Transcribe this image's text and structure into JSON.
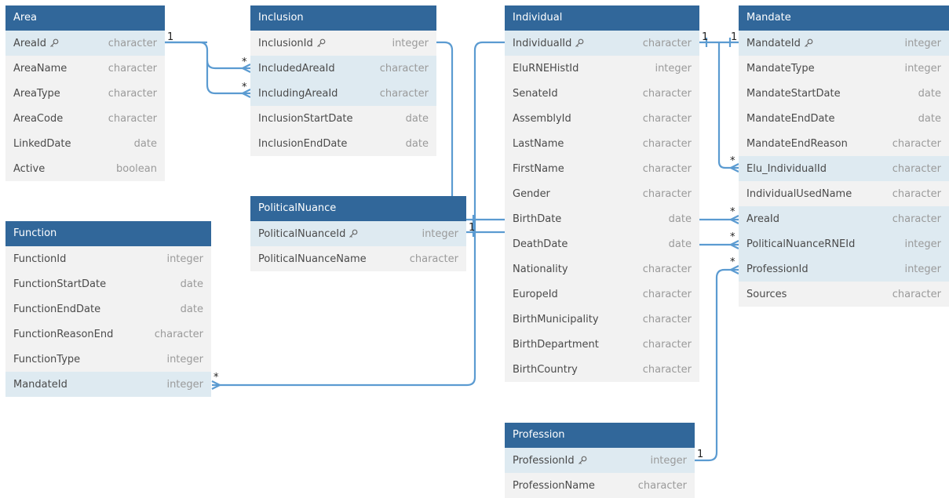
{
  "colors": {
    "header": "#31679a",
    "header_text": "#ffffff",
    "body": "#f2f2f2",
    "highlight_row": "#deeaf1",
    "relation": "#5b9bd1",
    "name_text": "#4a4a4a",
    "type_text": "#9a9a9a"
  },
  "tables": {
    "area": {
      "title": "Area",
      "columns": [
        {
          "name": "AreaId",
          "type": "character",
          "pk": true,
          "hl": true
        },
        {
          "name": "AreaName",
          "type": "character"
        },
        {
          "name": "AreaType",
          "type": "character"
        },
        {
          "name": "AreaCode",
          "type": "character"
        },
        {
          "name": "LinkedDate",
          "type": "date"
        },
        {
          "name": "Active",
          "type": "boolean"
        }
      ]
    },
    "inclusion": {
      "title": "Inclusion",
      "columns": [
        {
          "name": "InclusionId",
          "type": "integer",
          "pk": true
        },
        {
          "name": "IncludedAreaId",
          "type": "character",
          "hl": true
        },
        {
          "name": "IncludingAreaId",
          "type": "character",
          "hl": true
        },
        {
          "name": "InclusionStartDate",
          "type": "date"
        },
        {
          "name": "InclusionEndDate",
          "type": "date"
        }
      ]
    },
    "individual": {
      "title": "Individual",
      "columns": [
        {
          "name": "IndividualId",
          "type": "character",
          "pk": true,
          "hl": true
        },
        {
          "name": "EluRNEHistId",
          "type": "integer"
        },
        {
          "name": "SenateId",
          "type": "character"
        },
        {
          "name": "AssemblyId",
          "type": "character"
        },
        {
          "name": "LastName",
          "type": "character"
        },
        {
          "name": "FirstName",
          "type": "character"
        },
        {
          "name": "Gender",
          "type": "character"
        },
        {
          "name": "BirthDate",
          "type": "date"
        },
        {
          "name": "DeathDate",
          "type": "date"
        },
        {
          "name": "Nationality",
          "type": "character"
        },
        {
          "name": "EuropeId",
          "type": "character"
        },
        {
          "name": "BirthMunicipality",
          "type": "character"
        },
        {
          "name": "BirthDepartment",
          "type": "character"
        },
        {
          "name": "BirthCountry",
          "type": "character"
        }
      ]
    },
    "mandate": {
      "title": "Mandate",
      "columns": [
        {
          "name": "MandateId",
          "type": "integer",
          "pk": true,
          "hl": true
        },
        {
          "name": "MandateType",
          "type": "integer"
        },
        {
          "name": "MandateStartDate",
          "type": "date"
        },
        {
          "name": "MandateEndDate",
          "type": "date"
        },
        {
          "name": "MandateEndReason",
          "type": "character"
        },
        {
          "name": "Elu_IndividualId",
          "type": "character",
          "hl": true
        },
        {
          "name": "IndividualUsedName",
          "type": "character"
        },
        {
          "name": "AreaId",
          "type": "character",
          "hl": true
        },
        {
          "name": "PoliticalNuanceRNEId",
          "type": "integer",
          "hl": true
        },
        {
          "name": "ProfessionId",
          "type": "integer",
          "hl": true
        },
        {
          "name": "Sources",
          "type": "character"
        }
      ]
    },
    "function": {
      "title": "Function",
      "columns": [
        {
          "name": "FunctionId",
          "type": "integer"
        },
        {
          "name": "FunctionStartDate",
          "type": "date"
        },
        {
          "name": "FunctionEndDate",
          "type": "date"
        },
        {
          "name": "FunctionReasonEnd",
          "type": "character"
        },
        {
          "name": "FunctionType",
          "type": "integer"
        },
        {
          "name": "MandateId",
          "type": "integer",
          "hl": true
        }
      ]
    },
    "political_nuance": {
      "title": "PoliticalNuance",
      "columns": [
        {
          "name": "PoliticalNuanceId",
          "type": "integer",
          "pk": true,
          "hl": true
        },
        {
          "name": "PoliticalNuanceName",
          "type": "character"
        }
      ]
    },
    "profession": {
      "title": "Profession",
      "columns": [
        {
          "name": "ProfessionId",
          "type": "integer",
          "pk": true,
          "hl": true
        },
        {
          "name": "ProfessionName",
          "type": "character"
        }
      ]
    }
  },
  "cardinality": {
    "one": "1",
    "many": "*"
  }
}
